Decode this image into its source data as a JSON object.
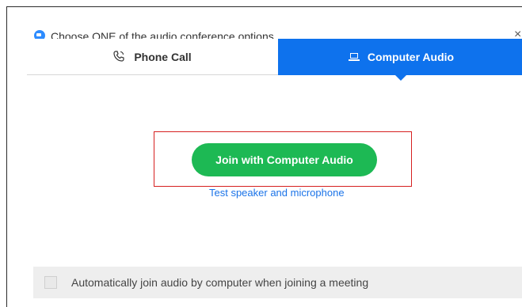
{
  "dialog": {
    "title": "Choose ONE of the audio conference options",
    "close_label": "×"
  },
  "tabs": [
    {
      "label": "Phone Call",
      "icon": "phone-icon",
      "active": false
    },
    {
      "label": "Computer Audio",
      "icon": "laptop-icon",
      "active": true
    }
  ],
  "main": {
    "join_button_label": "Join with Computer Audio",
    "test_link_label": "Test speaker and microphone"
  },
  "footer": {
    "auto_join_label": "Automatically join audio by computer when joining a meeting",
    "auto_join_checked": false
  },
  "colors": {
    "accent_blue": "#0e72ed",
    "join_green": "#1db954",
    "highlight_red": "#d62020",
    "link_blue": "#1a73e8"
  }
}
